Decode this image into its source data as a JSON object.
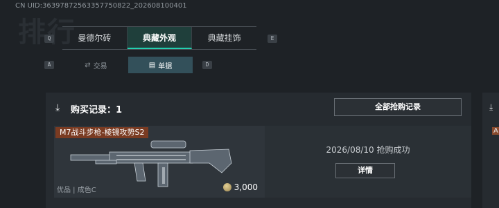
{
  "uid": "CN UID:3639787256335775082​2_202608100401",
  "bg_glyph": "排行",
  "keys": {
    "left_tab": "Q",
    "right_tab": "E",
    "left_sub": "A",
    "right_sub": "D"
  },
  "tabs": [
    {
      "label": "曼德尔砖",
      "active": false
    },
    {
      "label": "典藏外观",
      "active": true
    },
    {
      "label": "典藏挂饰",
      "active": false
    }
  ],
  "subtabs": [
    {
      "label": "交易",
      "icon": "trade-icon",
      "active": false
    },
    {
      "label": "单据",
      "icon": "receipt-icon",
      "active": true
    }
  ],
  "panel": {
    "title": "购买记录：1",
    "all_button": "全部抢购记录",
    "card": {
      "name": "M7战斗步枪-棱镜攻势S2",
      "quality": "优品 | 成色C",
      "price": "3,000"
    },
    "status": "2026/08/10 抢购成功",
    "detail_button": "详情"
  },
  "right_panel": {
    "tag": "A"
  },
  "colors": {
    "accent": "#23d0b0",
    "tag_bg": "#7a3b22"
  }
}
